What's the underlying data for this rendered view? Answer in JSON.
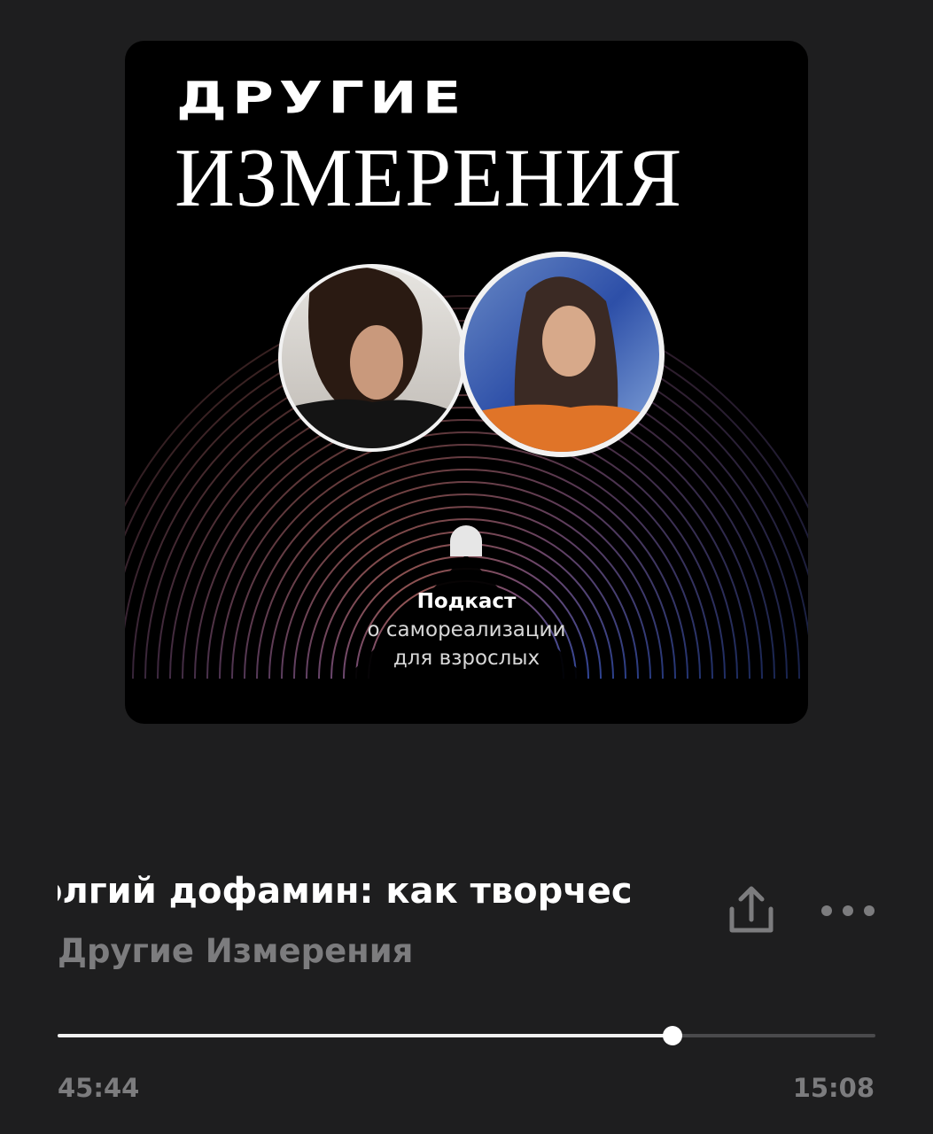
{
  "cover": {
    "title_line1": "ДРУГИЕ",
    "title_line2": "ИЗМЕРЕНИЯ",
    "caption_bold": "Подкаст",
    "caption_line2": "о самореализации",
    "caption_line3": "для взрослых"
  },
  "track": {
    "title": "олгий дофамин: как творчес",
    "artist": "Другие Измерения"
  },
  "actions": {
    "share_icon": "share-icon",
    "more_icon": "more-dots-icon"
  },
  "playback": {
    "elapsed": "45:44",
    "remaining": "15:08",
    "progress_fraction": 0.752
  },
  "colors": {
    "background": "#1e1e1f",
    "secondary_text": "#7c7c7e",
    "progress_fill": "#f2f2f2",
    "progress_track": "#4a4a4c"
  }
}
